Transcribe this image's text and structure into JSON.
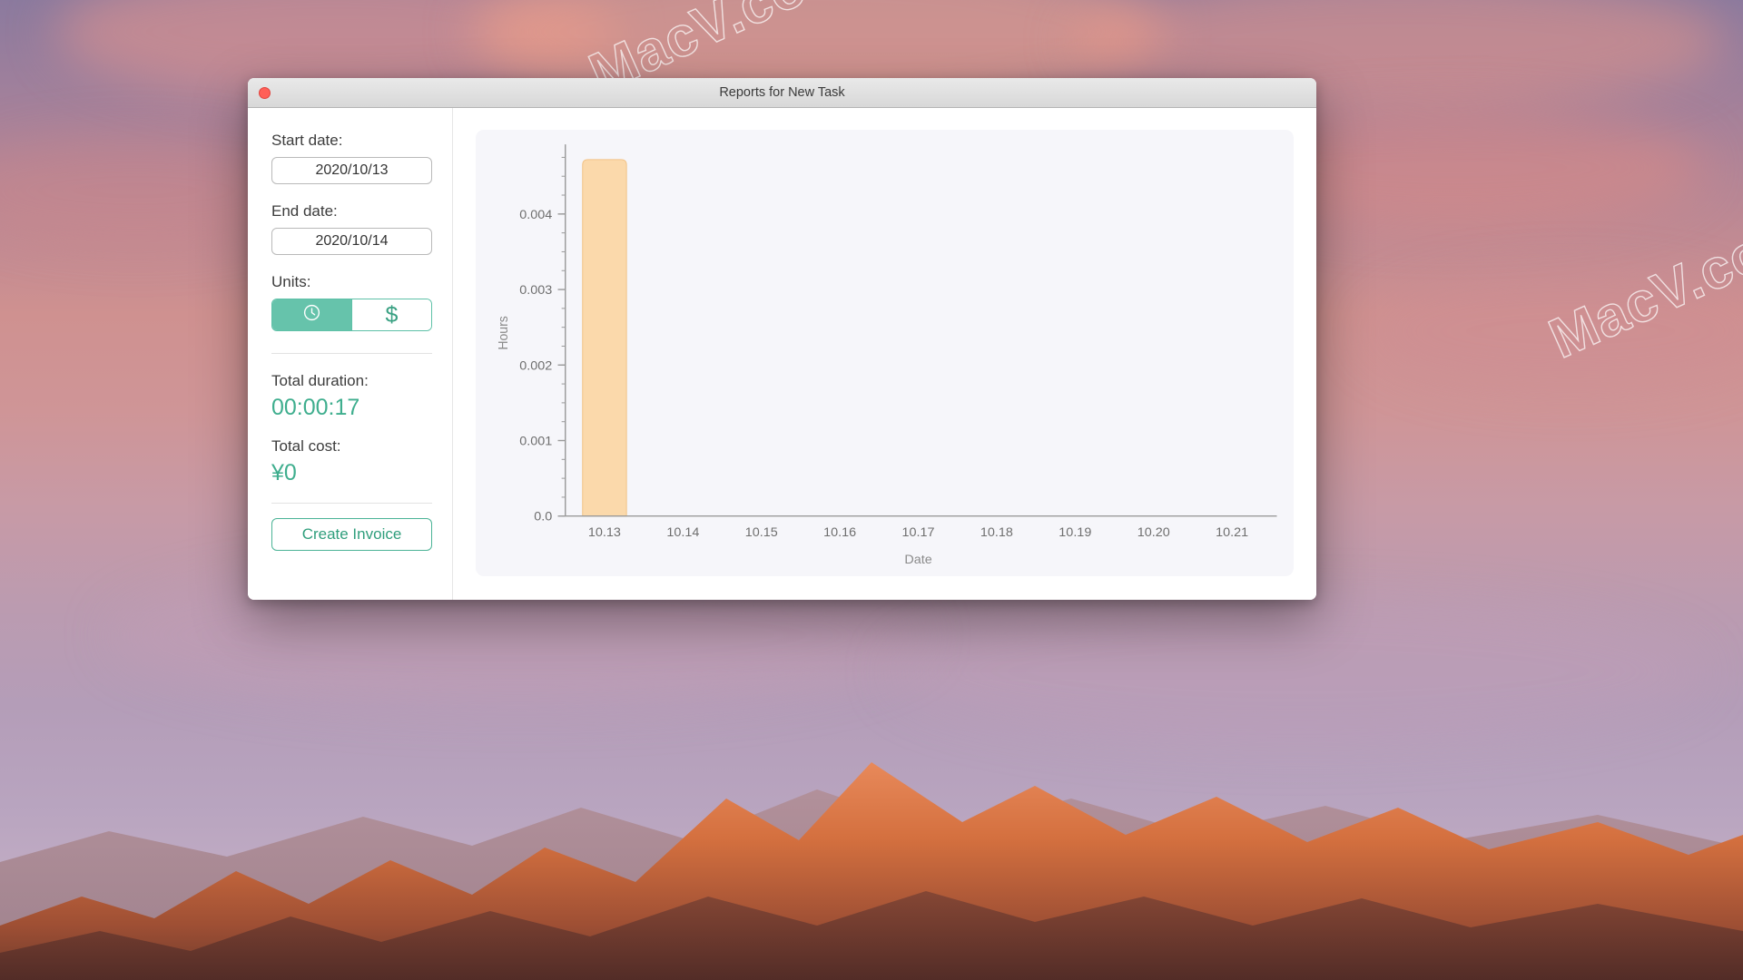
{
  "window": {
    "title": "Reports for New Task",
    "close_button": "close"
  },
  "sidebar": {
    "start_date": {
      "label": "Start date:",
      "value": "2020/10/13"
    },
    "end_date": {
      "label": "End date:",
      "value": "2020/10/14"
    },
    "units": {
      "label": "Units:",
      "options": [
        {
          "name": "time",
          "icon": "clock-icon",
          "selected": true
        },
        {
          "name": "money",
          "icon": "dollar-icon",
          "glyph": "$",
          "selected": false
        }
      ]
    },
    "total_duration": {
      "label": "Total duration:",
      "value": "00:00:17"
    },
    "total_cost": {
      "label": "Total cost:",
      "value": "¥0"
    },
    "create_invoice_label": "Create Invoice"
  },
  "colors": {
    "accent_teal": "#3fae8e",
    "toggle_green": "#66c3ab",
    "bar_peach": "#fbd9ab",
    "bar_peach_border": "#f2c488",
    "close_red": "#ff5f57",
    "chart_bg": "#f6f6fa"
  },
  "watermarks": [
    {
      "text": "MacV.com"
    },
    {
      "text": "MacV.co"
    },
    {
      "text": "MacV.com"
    }
  ],
  "chart_data": {
    "type": "bar",
    "title": "",
    "xlabel": "Date",
    "ylabel": "Hours",
    "categories": [
      "10.13",
      "10.14",
      "10.15",
      "10.16",
      "10.17",
      "10.18",
      "10.19",
      "10.20",
      "10.21"
    ],
    "values": [
      0.00472,
      0,
      0,
      0,
      0,
      0,
      0,
      0,
      0
    ],
    "ytick_labels": [
      "0.0",
      "0.001",
      "0.002",
      "0.003",
      "0.004"
    ],
    "ytick_values": [
      0.0,
      0.001,
      0.002,
      0.003,
      0.004
    ],
    "ylim": [
      0,
      0.00485
    ],
    "grid": false,
    "legend": false,
    "bar_color": "#fbd9ab"
  }
}
